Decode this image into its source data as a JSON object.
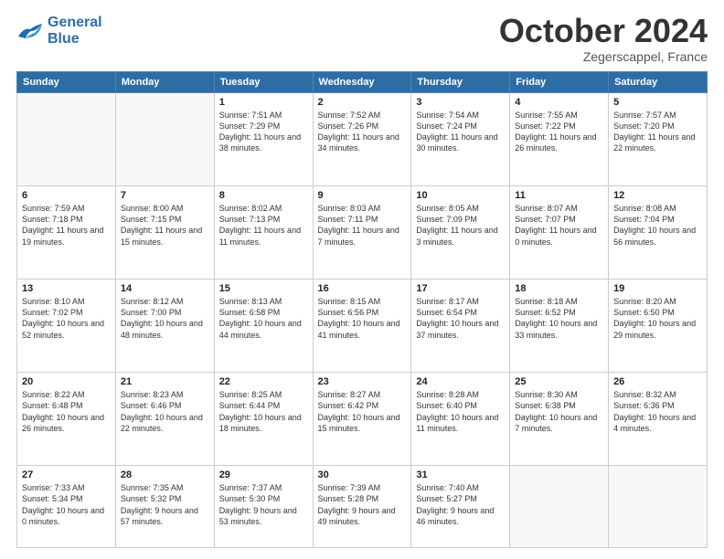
{
  "logo": {
    "line1": "General",
    "line2": "Blue"
  },
  "title": "October 2024",
  "location": "Zegerscappel, France",
  "weekdays": [
    "Sunday",
    "Monday",
    "Tuesday",
    "Wednesday",
    "Thursday",
    "Friday",
    "Saturday"
  ],
  "weeks": [
    [
      {
        "day": "",
        "info": ""
      },
      {
        "day": "",
        "info": ""
      },
      {
        "day": "1",
        "info": "Sunrise: 7:51 AM\nSunset: 7:29 PM\nDaylight: 11 hours and 38 minutes."
      },
      {
        "day": "2",
        "info": "Sunrise: 7:52 AM\nSunset: 7:26 PM\nDaylight: 11 hours and 34 minutes."
      },
      {
        "day": "3",
        "info": "Sunrise: 7:54 AM\nSunset: 7:24 PM\nDaylight: 11 hours and 30 minutes."
      },
      {
        "day": "4",
        "info": "Sunrise: 7:55 AM\nSunset: 7:22 PM\nDaylight: 11 hours and 26 minutes."
      },
      {
        "day": "5",
        "info": "Sunrise: 7:57 AM\nSunset: 7:20 PM\nDaylight: 11 hours and 22 minutes."
      }
    ],
    [
      {
        "day": "6",
        "info": "Sunrise: 7:59 AM\nSunset: 7:18 PM\nDaylight: 11 hours and 19 minutes."
      },
      {
        "day": "7",
        "info": "Sunrise: 8:00 AM\nSunset: 7:15 PM\nDaylight: 11 hours and 15 minutes."
      },
      {
        "day": "8",
        "info": "Sunrise: 8:02 AM\nSunset: 7:13 PM\nDaylight: 11 hours and 11 minutes."
      },
      {
        "day": "9",
        "info": "Sunrise: 8:03 AM\nSunset: 7:11 PM\nDaylight: 11 hours and 7 minutes."
      },
      {
        "day": "10",
        "info": "Sunrise: 8:05 AM\nSunset: 7:09 PM\nDaylight: 11 hours and 3 minutes."
      },
      {
        "day": "11",
        "info": "Sunrise: 8:07 AM\nSunset: 7:07 PM\nDaylight: 11 hours and 0 minutes."
      },
      {
        "day": "12",
        "info": "Sunrise: 8:08 AM\nSunset: 7:04 PM\nDaylight: 10 hours and 56 minutes."
      }
    ],
    [
      {
        "day": "13",
        "info": "Sunrise: 8:10 AM\nSunset: 7:02 PM\nDaylight: 10 hours and 52 minutes."
      },
      {
        "day": "14",
        "info": "Sunrise: 8:12 AM\nSunset: 7:00 PM\nDaylight: 10 hours and 48 minutes."
      },
      {
        "day": "15",
        "info": "Sunrise: 8:13 AM\nSunset: 6:58 PM\nDaylight: 10 hours and 44 minutes."
      },
      {
        "day": "16",
        "info": "Sunrise: 8:15 AM\nSunset: 6:56 PM\nDaylight: 10 hours and 41 minutes."
      },
      {
        "day": "17",
        "info": "Sunrise: 8:17 AM\nSunset: 6:54 PM\nDaylight: 10 hours and 37 minutes."
      },
      {
        "day": "18",
        "info": "Sunrise: 8:18 AM\nSunset: 6:52 PM\nDaylight: 10 hours and 33 minutes."
      },
      {
        "day": "19",
        "info": "Sunrise: 8:20 AM\nSunset: 6:50 PM\nDaylight: 10 hours and 29 minutes."
      }
    ],
    [
      {
        "day": "20",
        "info": "Sunrise: 8:22 AM\nSunset: 6:48 PM\nDaylight: 10 hours and 26 minutes."
      },
      {
        "day": "21",
        "info": "Sunrise: 8:23 AM\nSunset: 6:46 PM\nDaylight: 10 hours and 22 minutes."
      },
      {
        "day": "22",
        "info": "Sunrise: 8:25 AM\nSunset: 6:44 PM\nDaylight: 10 hours and 18 minutes."
      },
      {
        "day": "23",
        "info": "Sunrise: 8:27 AM\nSunset: 6:42 PM\nDaylight: 10 hours and 15 minutes."
      },
      {
        "day": "24",
        "info": "Sunrise: 8:28 AM\nSunset: 6:40 PM\nDaylight: 10 hours and 11 minutes."
      },
      {
        "day": "25",
        "info": "Sunrise: 8:30 AM\nSunset: 6:38 PM\nDaylight: 10 hours and 7 minutes."
      },
      {
        "day": "26",
        "info": "Sunrise: 8:32 AM\nSunset: 6:36 PM\nDaylight: 10 hours and 4 minutes."
      }
    ],
    [
      {
        "day": "27",
        "info": "Sunrise: 7:33 AM\nSunset: 5:34 PM\nDaylight: 10 hours and 0 minutes."
      },
      {
        "day": "28",
        "info": "Sunrise: 7:35 AM\nSunset: 5:32 PM\nDaylight: 9 hours and 57 minutes."
      },
      {
        "day": "29",
        "info": "Sunrise: 7:37 AM\nSunset: 5:30 PM\nDaylight: 9 hours and 53 minutes."
      },
      {
        "day": "30",
        "info": "Sunrise: 7:39 AM\nSunset: 5:28 PM\nDaylight: 9 hours and 49 minutes."
      },
      {
        "day": "31",
        "info": "Sunrise: 7:40 AM\nSunset: 5:27 PM\nDaylight: 9 hours and 46 minutes."
      },
      {
        "day": "",
        "info": ""
      },
      {
        "day": "",
        "info": ""
      }
    ]
  ]
}
